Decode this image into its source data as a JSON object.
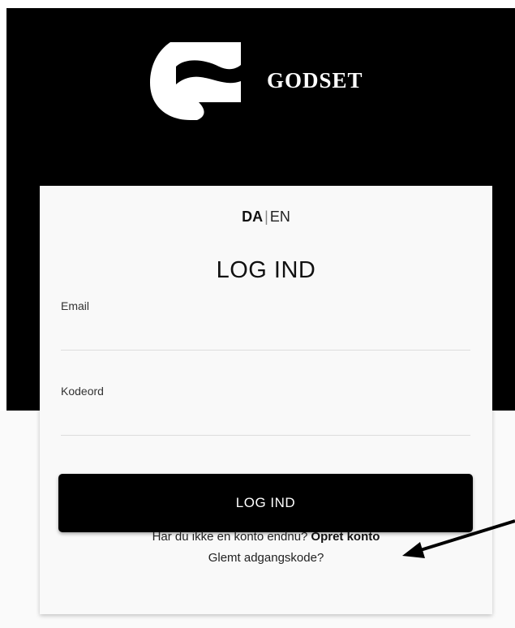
{
  "brand": {
    "name": "GODSET"
  },
  "language": {
    "active": "DA",
    "separator": "|",
    "alternate": "EN"
  },
  "login": {
    "title": "LOG IND",
    "email_label": "Email",
    "email_value": "",
    "password_label": "Kodeord",
    "password_value": "",
    "submit_label": "LOG IND",
    "signup_prompt": "Har du ikke en konto endnu?",
    "signup_link": "Opret konto",
    "forgot_link": "Glemt adgangskode?"
  },
  "colors": {
    "header_bg": "#000000",
    "card_bg": "#f9f9f9",
    "button_bg": "#000000",
    "button_text": "#ffffff"
  },
  "annotation": {
    "icon": "arrow-pointer-icon"
  }
}
